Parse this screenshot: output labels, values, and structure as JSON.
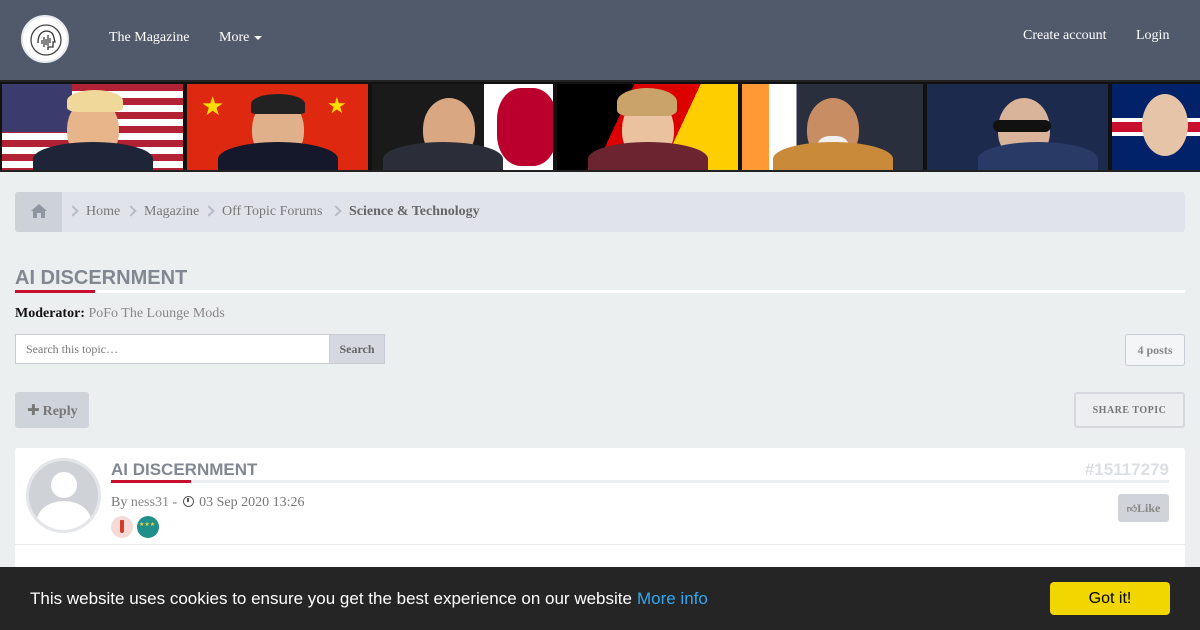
{
  "header": {
    "nav": [
      {
        "label": "The Magazine"
      },
      {
        "label": "More"
      }
    ],
    "create_account": "Create account",
    "login": "Login"
  },
  "banner": {
    "panels": [
      {
        "flag": "usa",
        "colors": [
          "#b22234",
          "#ffffff",
          "#3c3b6e"
        ]
      },
      {
        "flag": "china",
        "colors": [
          "#de2910",
          "#ffde00"
        ]
      },
      {
        "flag": "japan",
        "colors": [
          "#ffffff",
          "#bc002d",
          "#1a1a1a"
        ]
      },
      {
        "flag": "germany",
        "colors": [
          "#000000",
          "#dd0000",
          "#ffce00"
        ]
      },
      {
        "flag": "india",
        "colors": [
          "#ff9933",
          "#ffffff",
          "#2a2f3e"
        ]
      },
      {
        "flag": "russia",
        "colors": [
          "#1c2a4e",
          "#2a3a66"
        ]
      },
      {
        "flag": "uk",
        "colors": [
          "#012169",
          "#c8102e",
          "#ffffff"
        ]
      }
    ]
  },
  "breadcrumb": {
    "home_icon": "home-icon",
    "items": [
      "Home",
      "Magazine",
      "Off Topic Forums",
      "Science & Technology"
    ]
  },
  "topic": {
    "title": "AI DISCERNMENT",
    "moderator_label": "Moderator:",
    "moderator_name": "PoFo The Lounge Mods"
  },
  "search": {
    "placeholder": "Search this topic…",
    "button": "Search"
  },
  "posts_count": "4 posts",
  "actions": {
    "reply": "Reply",
    "share": "SHARE TOPIC"
  },
  "post": {
    "title": "AI DISCERNMENT",
    "id": "#15117279",
    "by_label": "By",
    "author": "ness31",
    "separator": "-",
    "date": "03 Sep 2020 13:26",
    "like": "Like"
  },
  "cookie": {
    "text": "This website uses cookies to ensure you get the best experience on our website",
    "link": "More info",
    "button": "Got it!"
  },
  "colors": {
    "header_bg": "#505a6b",
    "accent": "#c8102e",
    "cookie_button": "#f1d600",
    "cookie_link": "#31a8f0"
  }
}
